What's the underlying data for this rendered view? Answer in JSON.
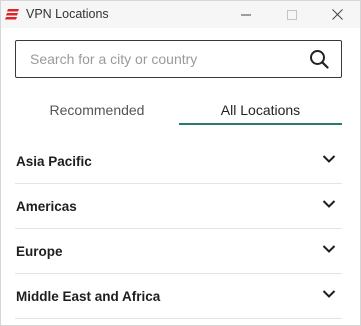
{
  "window": {
    "title": "VPN Locations"
  },
  "search": {
    "placeholder": "Search for a city or country",
    "value": ""
  },
  "tabs": [
    {
      "label": "Recommended",
      "active": false
    },
    {
      "label": "All Locations",
      "active": true
    }
  ],
  "regions": [
    {
      "label": "Asia Pacific"
    },
    {
      "label": "Americas"
    },
    {
      "label": "Europe"
    },
    {
      "label": "Middle East and Africa"
    }
  ],
  "colors": {
    "brand_red": "#d9262c",
    "active_tab_underline": "#2a7a6b"
  }
}
